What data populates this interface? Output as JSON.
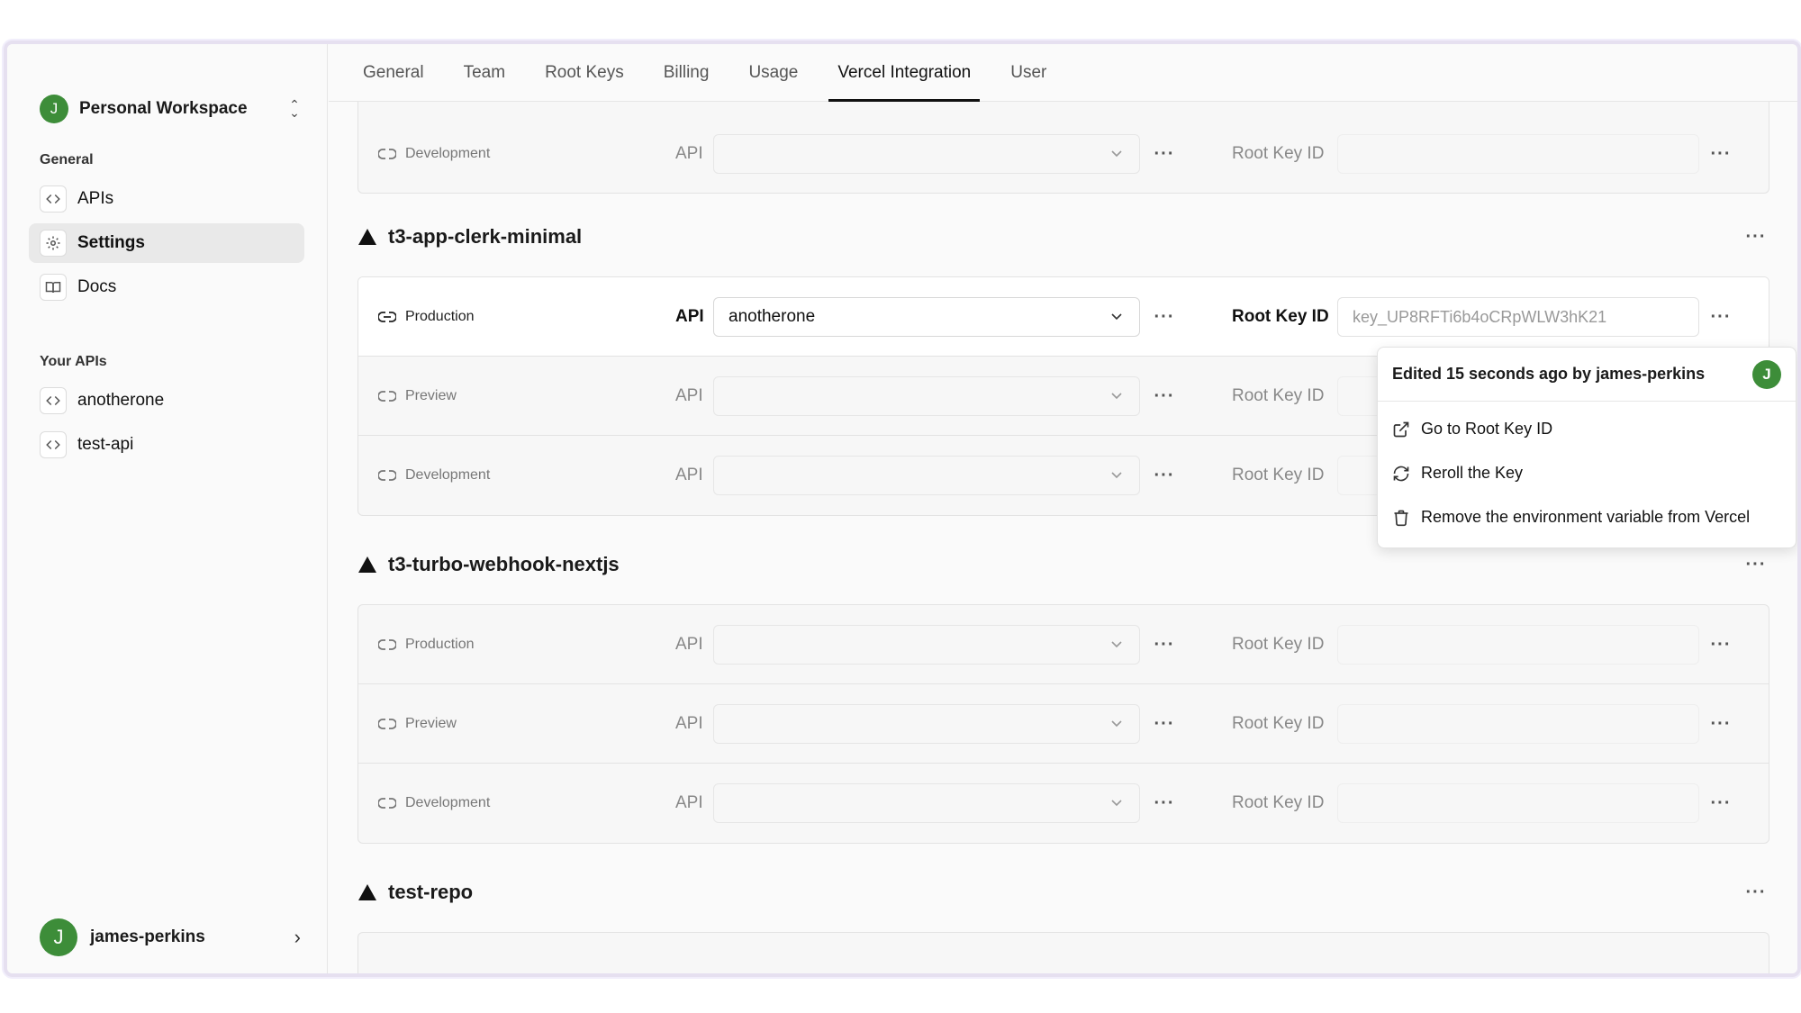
{
  "sidebar": {
    "workspace": {
      "avatar_initial": "J",
      "name": "Personal Workspace"
    },
    "general_label": "General",
    "general_items": [
      {
        "label": "APIs",
        "icon": "code-icon"
      },
      {
        "label": "Settings",
        "icon": "gear-icon",
        "active": true
      },
      {
        "label": "Docs",
        "icon": "book-icon"
      }
    ],
    "apis_label": "Your APIs",
    "api_items": [
      {
        "label": "anotherone",
        "icon": "code-icon"
      },
      {
        "label": "test-api",
        "icon": "code-icon"
      }
    ],
    "user": {
      "avatar_initial": "J",
      "name": "james-perkins"
    }
  },
  "tabs": [
    "General",
    "Team",
    "Root Keys",
    "Billing",
    "Usage",
    "Vercel Integration",
    "User"
  ],
  "active_tab": "Vercel Integration",
  "labels": {
    "api": "API",
    "root_key": "Root Key ID"
  },
  "partial_card": {
    "rows": [
      {
        "env": "Development"
      }
    ]
  },
  "projects": [
    {
      "name": "t3-app-clerk-minimal",
      "rows": [
        {
          "env": "Production",
          "api_value": "anotherone",
          "key_value": "key_UP8RFTi6b4oCRpWLW3hK21"
        },
        {
          "env": "Preview",
          "api_value": "",
          "key_value": ""
        },
        {
          "env": "Development",
          "api_value": "",
          "key_value": ""
        }
      ]
    },
    {
      "name": "t3-turbo-webhook-nextjs",
      "rows": [
        {
          "env": "Production",
          "api_value": "",
          "key_value": ""
        },
        {
          "env": "Preview",
          "api_value": "",
          "key_value": ""
        },
        {
          "env": "Development",
          "api_value": "",
          "key_value": ""
        }
      ]
    },
    {
      "name": "test-repo"
    }
  ],
  "context_menu": {
    "header": "Edited 15 seconds ago by james-perkins",
    "avatar_initial": "J",
    "items": [
      {
        "label": "Go to Root Key ID",
        "icon": "external-link-icon"
      },
      {
        "label": "Reroll the Key",
        "icon": "refresh-icon"
      },
      {
        "label": "Remove the environment variable from Vercel",
        "icon": "trash-icon"
      }
    ]
  },
  "colors": {
    "avatar": "#3d8d39",
    "annotation_arrow": "#e8201f"
  }
}
